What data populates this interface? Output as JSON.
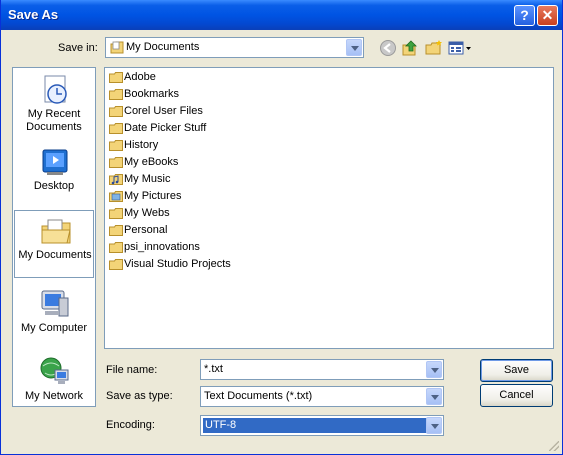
{
  "window": {
    "title": "Save As"
  },
  "titlebar": {
    "help_label": "?",
    "close_label": "✕"
  },
  "save_in": {
    "label": "Save in:",
    "value": "My Documents"
  },
  "toolbar": {
    "back_icon": "back-icon",
    "up_icon": "up-folder-icon",
    "new_folder_icon": "new-folder-icon",
    "views_icon": "views-menu-icon"
  },
  "places": [
    {
      "label": "My Recent Documents",
      "icon": "recent-documents-icon"
    },
    {
      "label": "Desktop",
      "icon": "desktop-icon"
    },
    {
      "label": "My Documents",
      "icon": "my-documents-icon",
      "selected": true
    },
    {
      "label": "My Computer",
      "icon": "my-computer-icon"
    },
    {
      "label": "My Network",
      "icon": "my-network-icon"
    }
  ],
  "files": [
    {
      "name": "Adobe",
      "icon": "folder-icon"
    },
    {
      "name": "Bookmarks",
      "icon": "folder-icon"
    },
    {
      "name": "Corel User Files",
      "icon": "folder-icon"
    },
    {
      "name": "Date Picker Stuff",
      "icon": "folder-icon"
    },
    {
      "name": "History",
      "icon": "folder-icon"
    },
    {
      "name": "My eBooks",
      "icon": "folder-icon"
    },
    {
      "name": "My Music",
      "icon": "music-folder-icon"
    },
    {
      "name": "My Pictures",
      "icon": "pictures-folder-icon"
    },
    {
      "name": "My Webs",
      "icon": "folder-icon"
    },
    {
      "name": "Personal",
      "icon": "folder-icon"
    },
    {
      "name": "psi_innovations",
      "icon": "folder-icon"
    },
    {
      "name": "Visual Studio Projects",
      "icon": "folder-icon"
    }
  ],
  "form": {
    "file_name_label": "File name:",
    "file_name_value": "*.txt",
    "save_as_type_label": "Save as type:",
    "save_as_type_value": "Text Documents (*.txt)",
    "encoding_label": "Encoding:",
    "encoding_value": "UTF-8"
  },
  "buttons": {
    "save": "Save",
    "cancel": "Cancel"
  },
  "colors": {
    "title_blue": "#0054e3",
    "selection": "#316ac5",
    "dialog_bg": "#ece9d8"
  }
}
